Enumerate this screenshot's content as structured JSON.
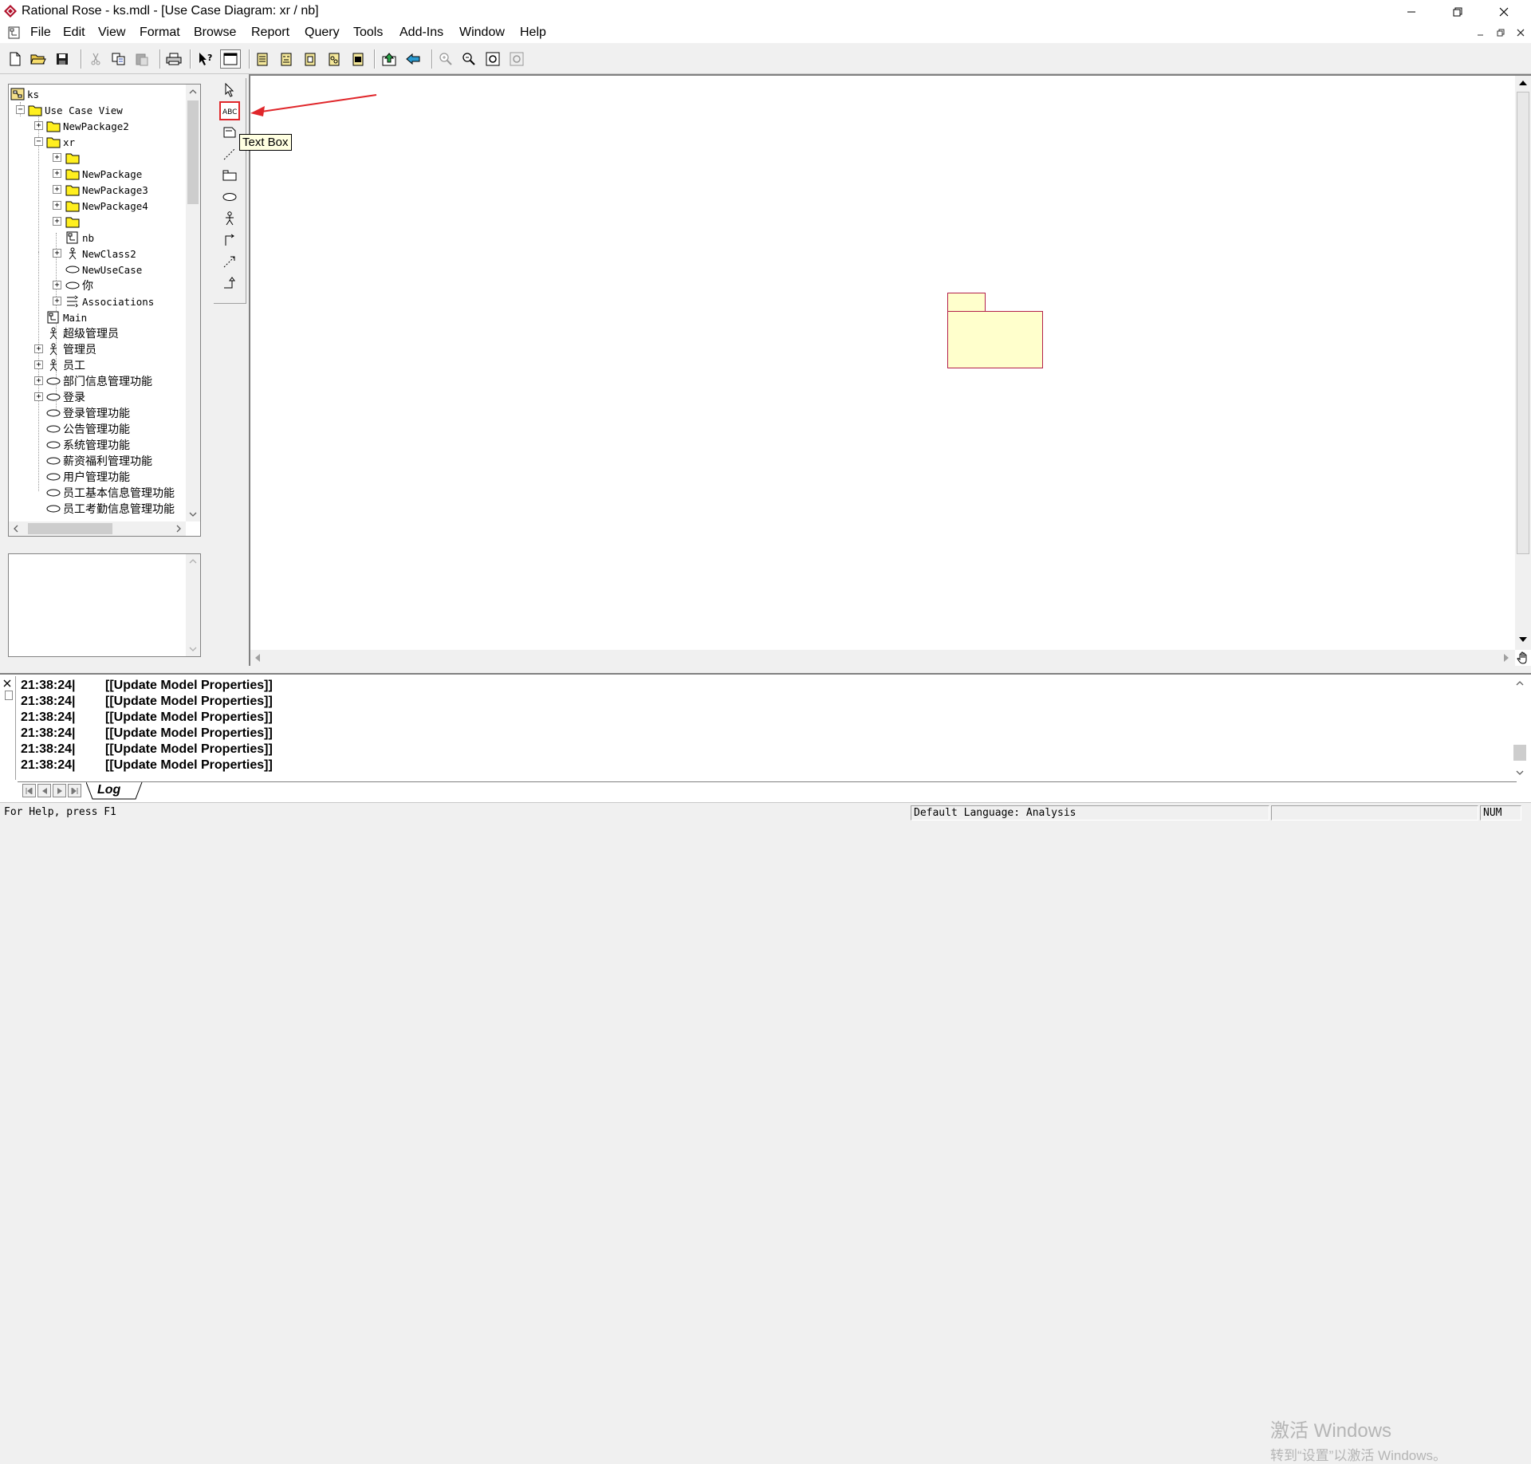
{
  "window": {
    "title": "Rational Rose - ks.mdl - [Use Case Diagram: xr / nb]"
  },
  "menu": {
    "items": [
      "File",
      "Edit",
      "View",
      "Format",
      "Browse",
      "Report",
      "Query",
      "Tools",
      "Add-Ins",
      "Window",
      "Help"
    ]
  },
  "tree": {
    "root": "ks",
    "use_case_view": "Use Case View",
    "newpackage2": "NewPackage2",
    "xr": "xr",
    "newpackage": "NewPackage",
    "newpackage3": "NewPackage3",
    "newpackage4": "NewPackage4",
    "nb": "nb",
    "newclass2": "NewClass2",
    "newusecase": "NewUseCase",
    "ni": "你",
    "associations": "Associations",
    "main": "Main",
    "super_admin": "超级管理员",
    "admin": "管理员",
    "employee": "员工",
    "dept_info": "部门信息管理功能",
    "login": "登录",
    "login_mgmt": "登录管理功能",
    "notice_mgmt": "公告管理功能",
    "system_mgmt": "系统管理功能",
    "salary_mgmt": "薪资福利管理功能",
    "user_mgmt": "用户管理功能",
    "emp_basic": "员工基本信息管理功能",
    "emp_attendance": "员工考勤信息管理功能"
  },
  "tooltip": {
    "text": "Text Box"
  },
  "log": {
    "lines": [
      {
        "time": "21:38:24|",
        "msg": "[[Update Model Properties]]"
      },
      {
        "time": "21:38:24|",
        "msg": "[[Update Model Properties]]"
      },
      {
        "time": "21:38:24|",
        "msg": "[[Update Model Properties]]"
      },
      {
        "time": "21:38:24|",
        "msg": "[[Update Model Properties]]"
      },
      {
        "time": "21:38:24|",
        "msg": "[[Update Model Properties]]"
      },
      {
        "time": "21:38:24|",
        "msg": "[[Update Model Properties]]"
      }
    ],
    "tab_label": "Log"
  },
  "watermark": {
    "line1": "激活 Windows",
    "line2": "转到“设置”以激活 Windows。"
  },
  "status": {
    "help": "For Help, press F1",
    "language": "Default Language: Analysis",
    "num": "NUM"
  },
  "colors": {
    "package_fill": "#ffffcc",
    "package_border": "#b31f4a",
    "highlight": "#e0262a",
    "tooltip_bg": "#ffffe1"
  }
}
